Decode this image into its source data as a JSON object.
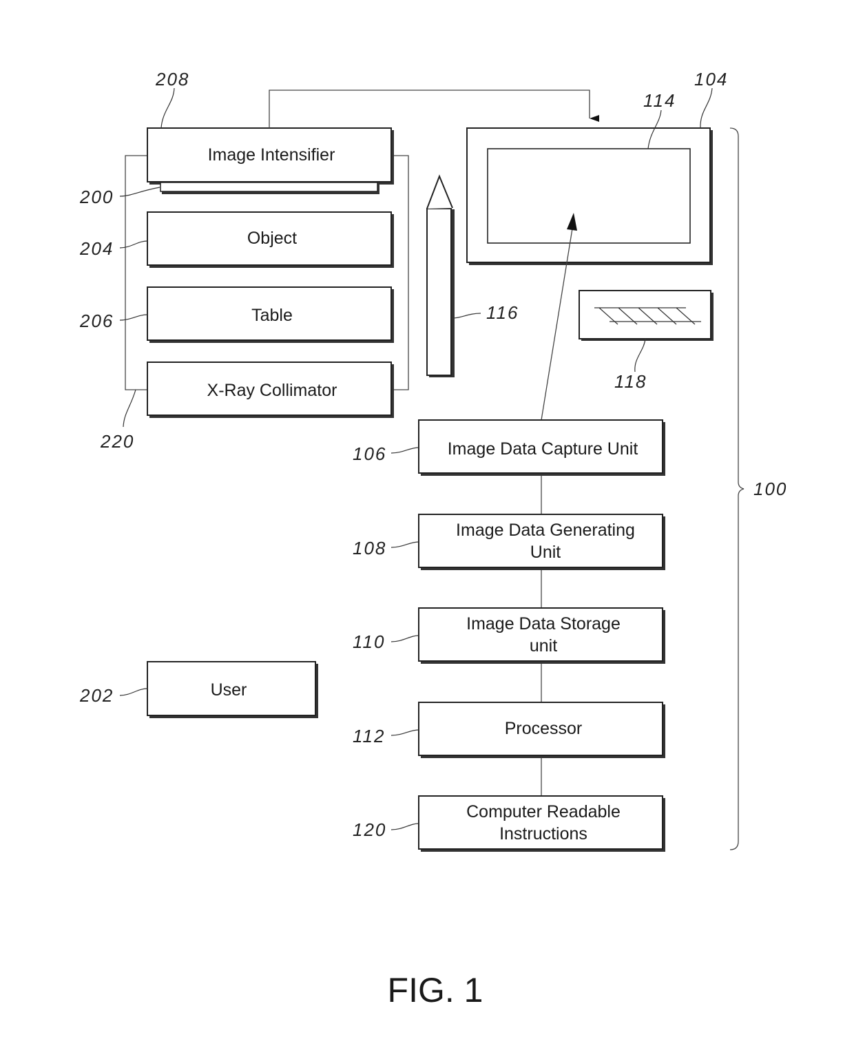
{
  "figure": {
    "caption": "FIG. 1"
  },
  "blocks": {
    "image_intensifier": {
      "label": "Image Intensifier",
      "ref": "208"
    },
    "detector_plate": {
      "ref": "200"
    },
    "object": {
      "label": "Object",
      "ref": "204"
    },
    "table": {
      "label": "Table",
      "ref": "206"
    },
    "xray_collimator": {
      "label": "X-Ray Collimator",
      "ref": "220"
    },
    "user": {
      "label": "User",
      "ref": "202"
    },
    "display": {
      "ref": "104"
    },
    "screen": {
      "ref": "114"
    },
    "stylus": {
      "ref": "116"
    },
    "keyboard": {
      "ref": "118"
    },
    "capture_unit": {
      "lines": [
        "Image Data Capture Unit"
      ],
      "ref": "106"
    },
    "generating_unit": {
      "lines": [
        "Image Data Generating",
        "Unit"
      ],
      "ref": "108"
    },
    "storage_unit": {
      "lines": [
        "Image Data Storage",
        "unit"
      ],
      "ref": "110"
    },
    "processor": {
      "lines": [
        "Processor"
      ],
      "ref": "112"
    },
    "instructions": {
      "lines": [
        "Computer Readable",
        "Instructions"
      ],
      "ref": "120"
    },
    "system": {
      "ref": "100"
    }
  }
}
